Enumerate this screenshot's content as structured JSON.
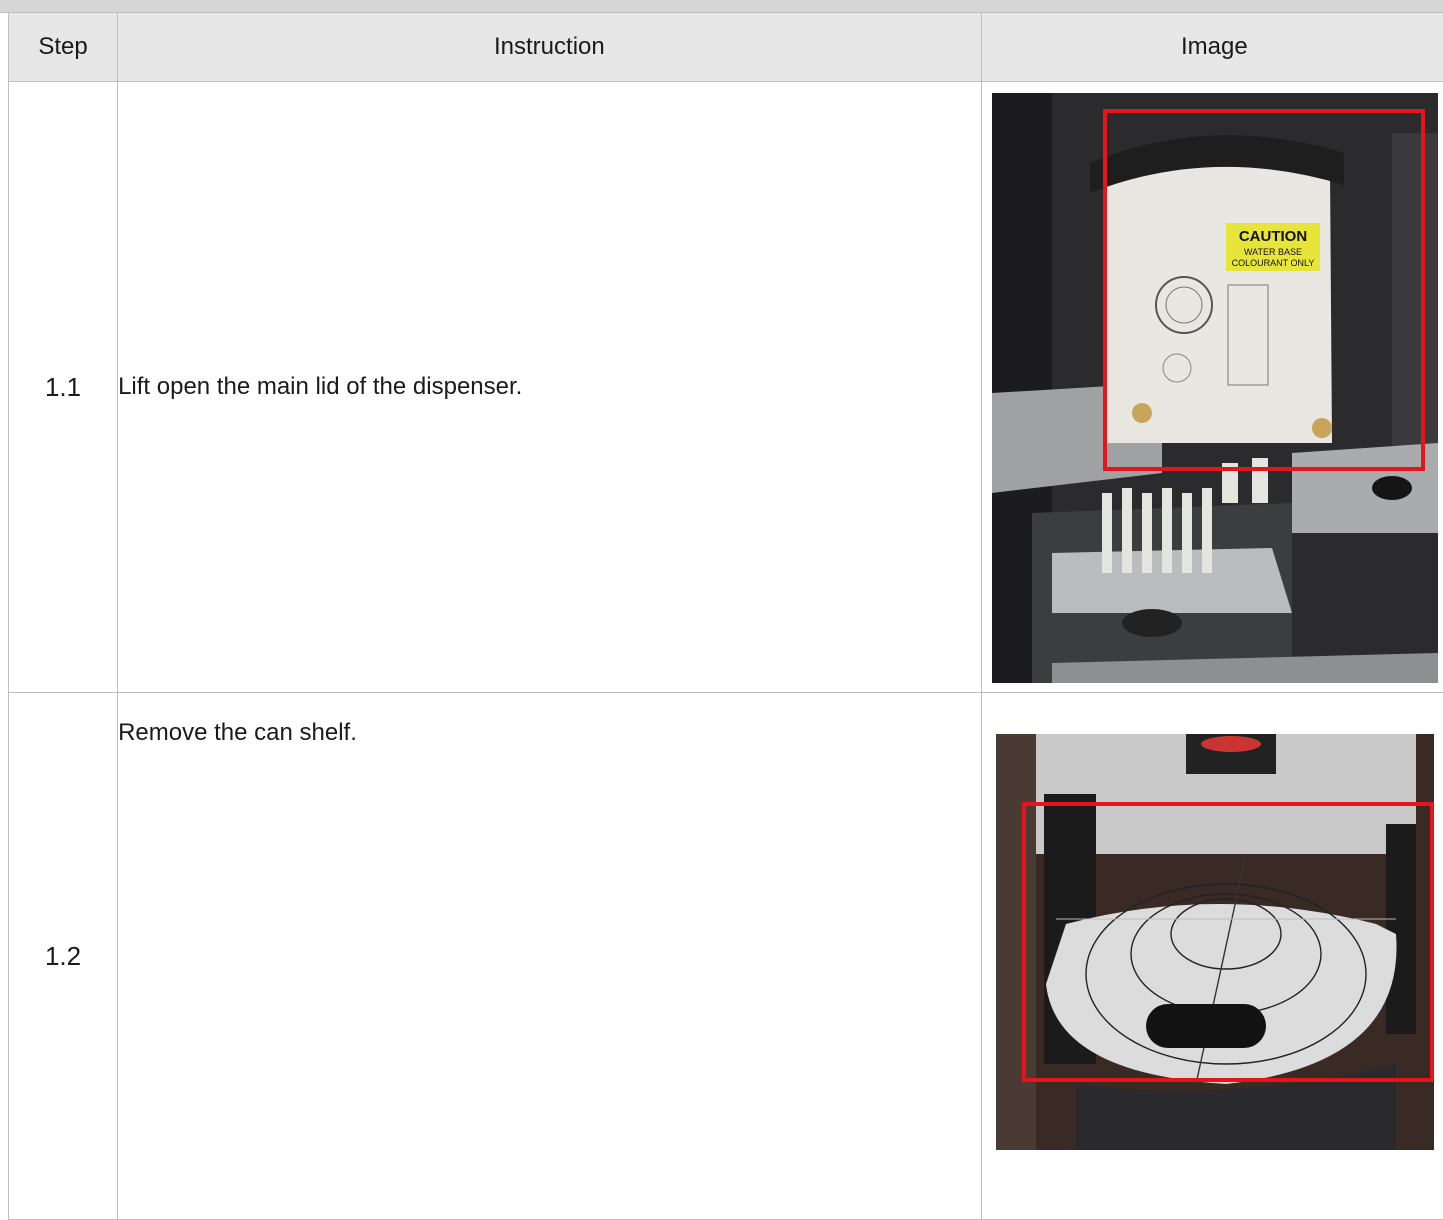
{
  "table": {
    "headers": {
      "step": "Step",
      "instruction": "Instruction",
      "image": "Image"
    },
    "rows": [
      {
        "step": "1.1",
        "instruction": "Lift open the main lid of the dispenser.",
        "image": {
          "subject": "dispenser-open-lid",
          "sticker_line1": "CAUTION",
          "sticker_line2": "WATER BASE",
          "sticker_line3": "COLOURANT ONLY",
          "highlight_color": "#e8141c"
        }
      },
      {
        "step": "1.2",
        "instruction": "Remove the can shelf.",
        "image": {
          "subject": "dispenser-can-shelf",
          "highlight_color": "#e8141c"
        }
      }
    ]
  }
}
